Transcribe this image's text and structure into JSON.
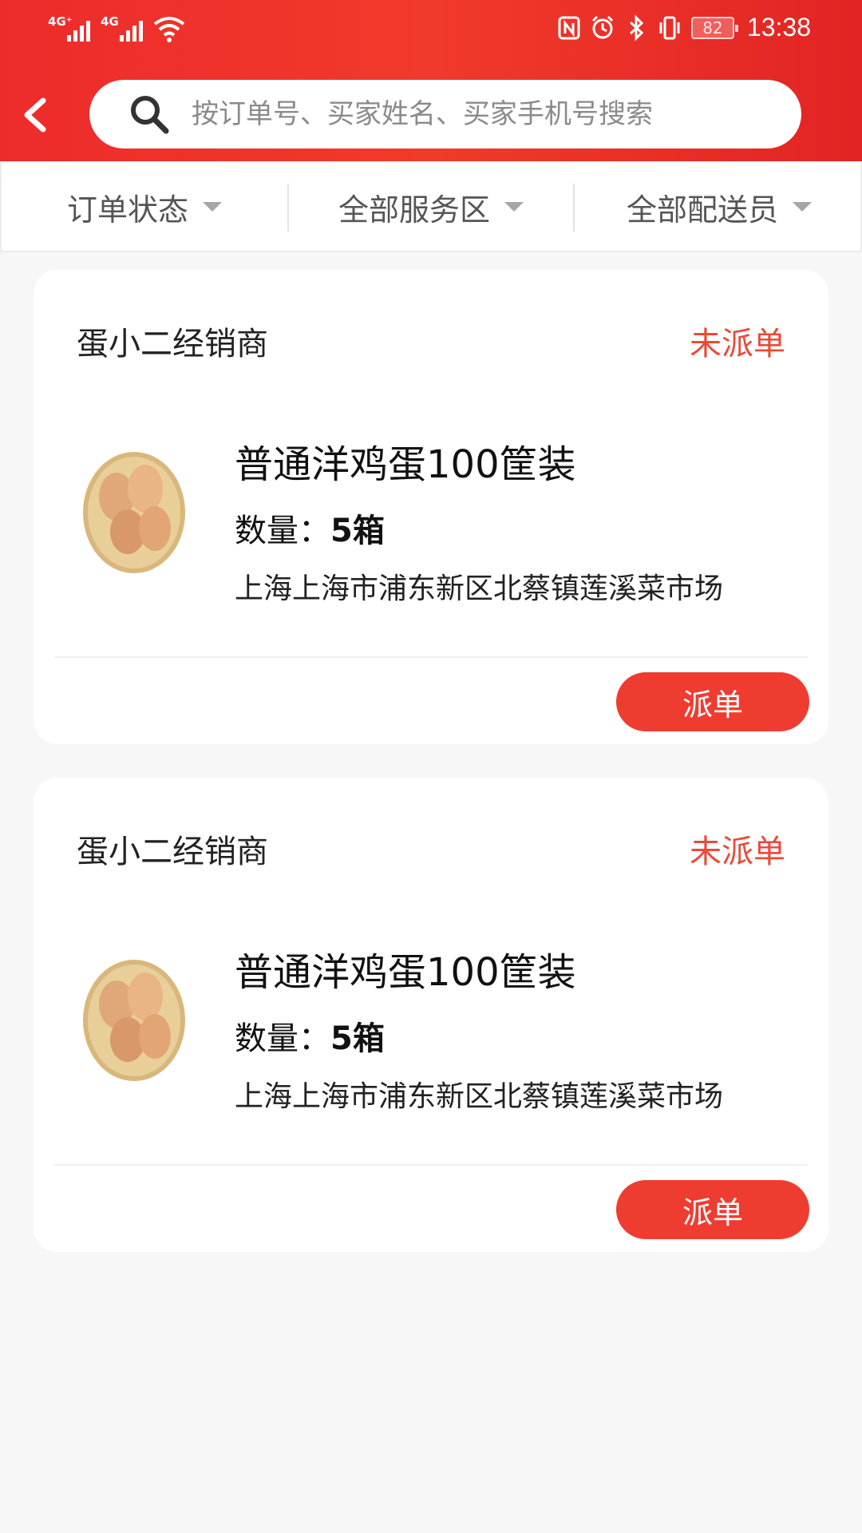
{
  "status_bar": {
    "network_1": "4G⁺",
    "network_2": "4G",
    "battery": "82",
    "time": "13:38"
  },
  "search": {
    "placeholder": "按订单号、买家姓名、买家手机号搜索"
  },
  "filters": [
    {
      "label": "订单状态"
    },
    {
      "label": "全部服务区"
    },
    {
      "label": "全部配送员"
    }
  ],
  "orders": [
    {
      "shop": "蛋小二经销商",
      "status": "未派单",
      "product_name": "普通洋鸡蛋100筐装",
      "qty_label": "数量：",
      "qty_value": "5箱",
      "address": "上海上海市浦东新区北蔡镇莲溪菜市场",
      "action_label": "派单"
    },
    {
      "shop": "蛋小二经销商",
      "status": "未派单",
      "product_name": "普通洋鸡蛋100筐装",
      "qty_label": "数量：",
      "qty_value": "5箱",
      "address": "上海上海市浦东新区北蔡镇莲溪菜市场",
      "action_label": "派单"
    }
  ],
  "colors": {
    "header_red": "#ee2b2b",
    "status_red": "#ea4a36",
    "button_red": "#ef3c31"
  }
}
